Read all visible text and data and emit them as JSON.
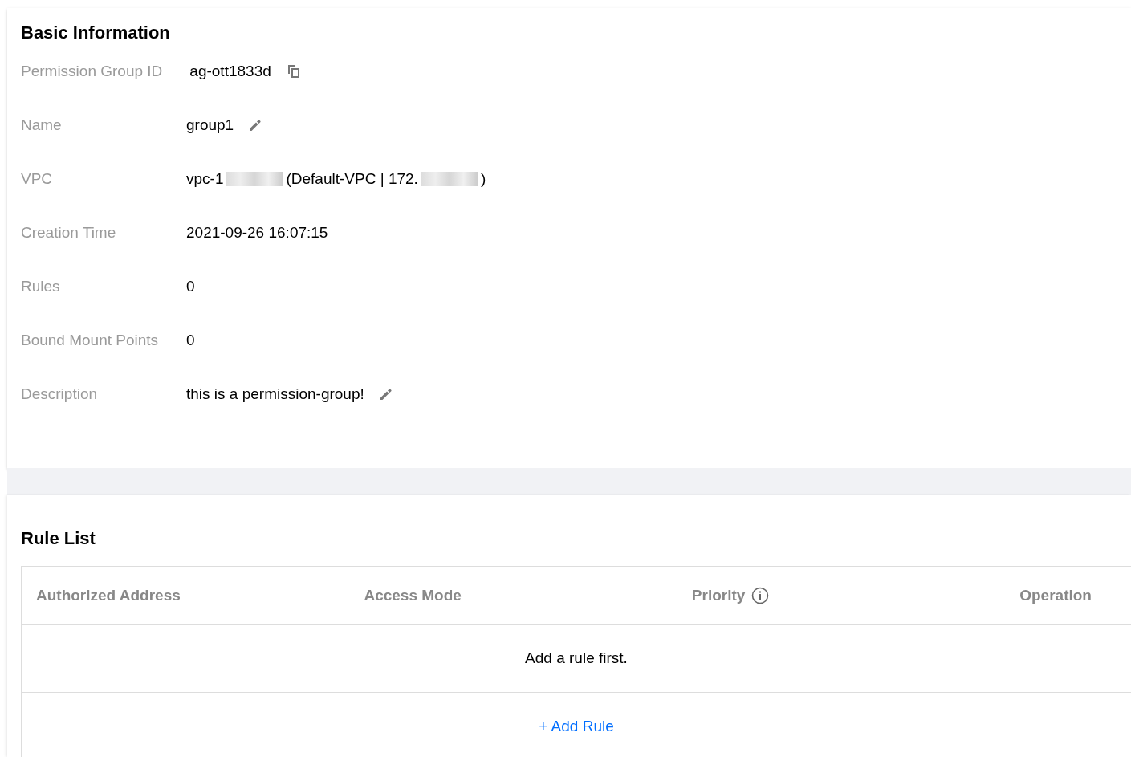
{
  "basic_information": {
    "title": "Basic Information",
    "fields": [
      {
        "label": "Permission Group ID",
        "kind": "copy",
        "parts": [
          {
            "kind": "text",
            "text": "ag-ott1833d"
          }
        ]
      },
      {
        "label": "Name",
        "kind": "edit",
        "parts": [
          {
            "kind": "text",
            "text": "group1"
          }
        ]
      },
      {
        "label": "VPC",
        "kind": "plain",
        "parts": [
          {
            "kind": "text",
            "text": "vpc-1"
          },
          {
            "kind": "redacted"
          },
          {
            "kind": "text",
            "text": "(Default-VPC | 172."
          },
          {
            "kind": "redacted"
          },
          {
            "kind": "text",
            "text": ")"
          }
        ]
      },
      {
        "label": "Creation Time",
        "kind": "plain",
        "parts": [
          {
            "kind": "text",
            "text": "2021-09-26 16:07:15"
          }
        ]
      },
      {
        "label": "Rules",
        "kind": "plain",
        "parts": [
          {
            "kind": "text",
            "text": "0"
          }
        ]
      },
      {
        "label": "Bound Mount Points",
        "kind": "plain",
        "parts": [
          {
            "kind": "text",
            "text": "0"
          }
        ]
      },
      {
        "label": "Description",
        "kind": "edit",
        "parts": [
          {
            "kind": "text",
            "text": "this is a permission-group!"
          }
        ]
      }
    ]
  },
  "rule_list": {
    "title": "Rule List",
    "columns": [
      {
        "label": "Authorized Address",
        "kind": "plain"
      },
      {
        "label": "Access Mode",
        "kind": "plain"
      },
      {
        "label": "Priority",
        "kind": "info"
      },
      {
        "label": "Operation",
        "kind": "plain"
      }
    ],
    "empty_text": "Add a rule first.",
    "add_button": "+ Add Rule"
  }
}
